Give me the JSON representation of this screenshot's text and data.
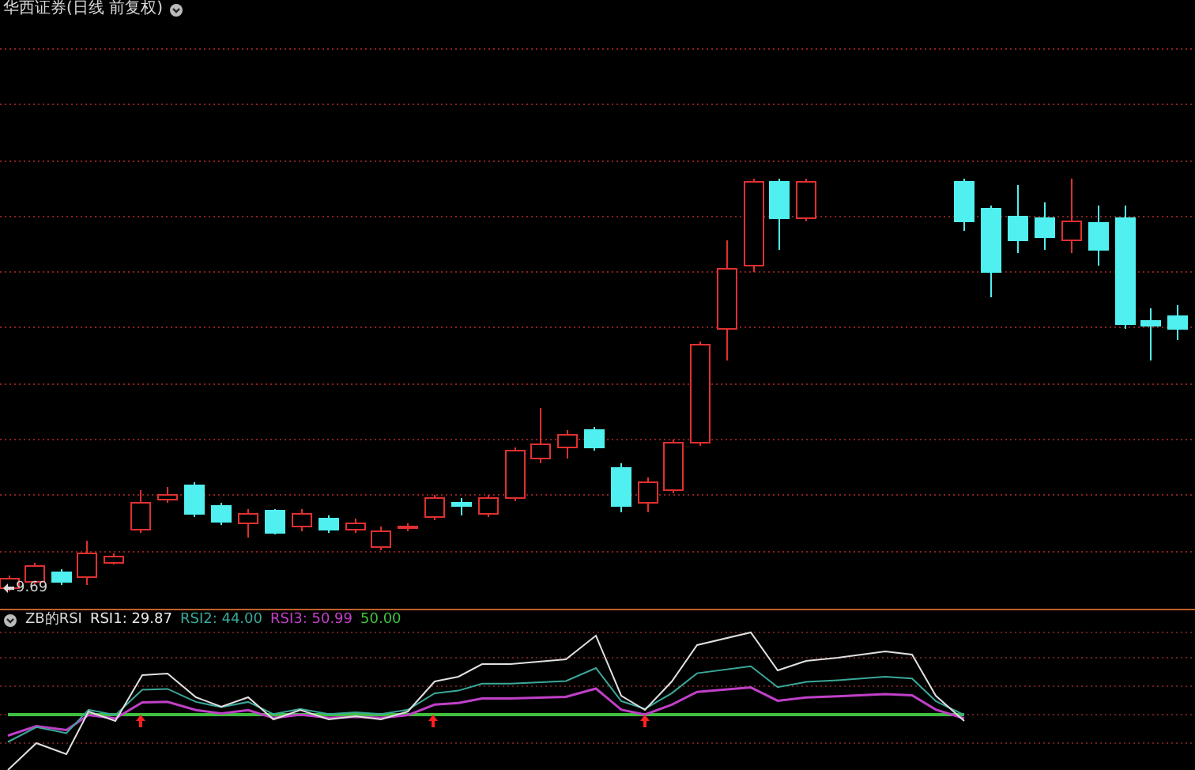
{
  "main_chart": {
    "title": "华西证券(日线 前复权)",
    "low_price_label": "9.69"
  },
  "indicator": {
    "legend": [
      {
        "text": "ZB的RSI",
        "color": "#d8d8d8"
      },
      {
        "text": "RSI1: 29.87",
        "color": "#e8e8e8"
      },
      {
        "text": "RSI2: 44.00",
        "color": "#3aa89a"
      },
      {
        "text": "RSI3: 50.99",
        "color": "#c040c8"
      },
      {
        "text": "50.00",
        "color": "#40c040"
      }
    ]
  }
}
